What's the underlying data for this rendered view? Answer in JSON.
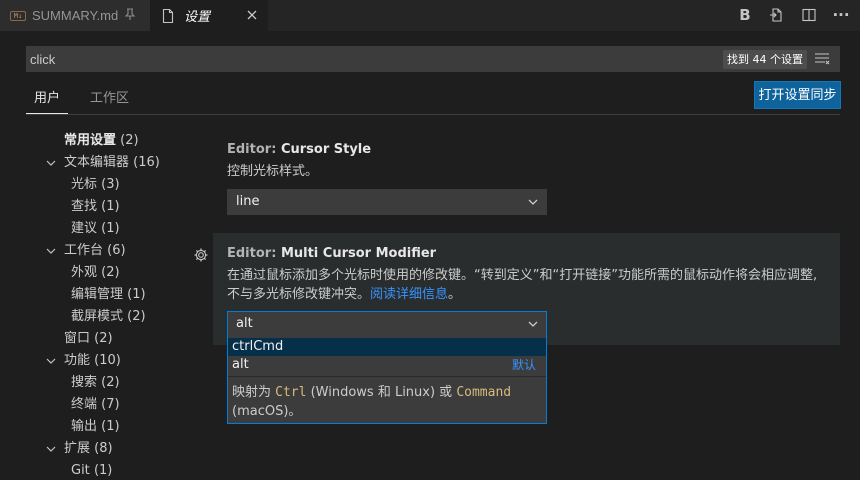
{
  "tabs": {
    "summary_label": "SUMMARY.md",
    "summary_badge": "M↓",
    "settings_label": "设置"
  },
  "toolbar": {
    "bold_label": "B",
    "more_label": "···"
  },
  "search": {
    "value": "click",
    "placeholder": "",
    "result_count": "找到 44 个设置"
  },
  "scope": {
    "user_label": "用户",
    "workspace_label": "工作区",
    "sync_button": "打开设置同步"
  },
  "toc": {
    "items": [
      {
        "label": "常用设置",
        "count": "(2)"
      },
      {
        "label": "文本编辑器",
        "count": "(16)"
      },
      {
        "label": "光标",
        "count": "(3)"
      },
      {
        "label": "查找",
        "count": "(1)"
      },
      {
        "label": "建议",
        "count": "(1)"
      },
      {
        "label": "工作台",
        "count": "(6)"
      },
      {
        "label": "外观",
        "count": "(2)"
      },
      {
        "label": "编辑管理",
        "count": "(1)"
      },
      {
        "label": "截屏模式",
        "count": "(2)"
      },
      {
        "label": "窗口",
        "count": "(2)"
      },
      {
        "label": "功能",
        "count": "(10)"
      },
      {
        "label": "搜索",
        "count": "(2)"
      },
      {
        "label": "终端",
        "count": "(7)"
      },
      {
        "label": "输出",
        "count": "(1)"
      },
      {
        "label": "扩展",
        "count": "(8)"
      },
      {
        "label": "Git",
        "count": "(1)"
      }
    ]
  },
  "cursor_style": {
    "category": "Editor: ",
    "name": "Cursor Style",
    "description": "控制光标样式。",
    "value": "line"
  },
  "multi_cursor": {
    "category": "Editor: ",
    "name": "Multi Cursor Modifier",
    "description_1": "在通过鼠标添加多个光标时使用的修改键。“转到定义”和“打开链接”功能所需的鼠标动作将会相应调整,",
    "description_2": "不与多光标修改键冲突。",
    "link": "阅读详细信息",
    "period": "。",
    "value": "alt",
    "options": [
      {
        "label": "ctrlCmd"
      },
      {
        "label": "alt",
        "default": "默认"
      }
    ],
    "option_desc": {
      "prefix": "映射为 ",
      "code1": "Ctrl",
      "middle": " (Windows 和 Linux) 或 ",
      "code2": "Command",
      "suffix": "(macOS)。"
    }
  }
}
